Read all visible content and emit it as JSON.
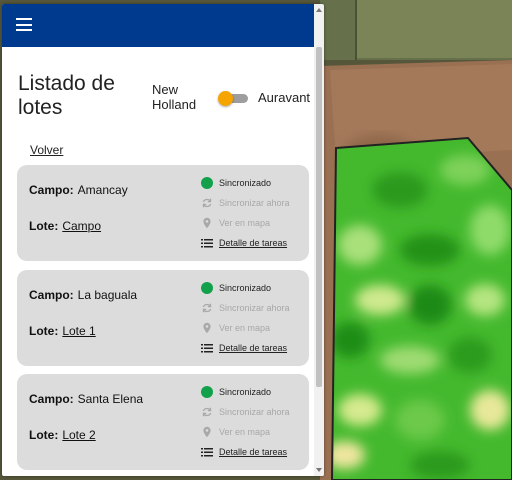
{
  "header": {
    "menu_icon": "hamburger-menu-icon",
    "color": "#003a8f"
  },
  "panel": {
    "title": "Listado de lotes",
    "brand_left": "New Holland",
    "brand_right": "Auravant",
    "toggle_color": "#f6a500",
    "back_label": "Volver"
  },
  "labels": {
    "campo": "Campo:",
    "lote": "Lote:",
    "sincronizado": "Sincronizado",
    "sincronizar": "Sincronizar ahora",
    "ver_mapa": "Ver en mapa",
    "detalle": "Detalle de tareas"
  },
  "cards": [
    {
      "campo": "Amancay",
      "lote": "Campo"
    },
    {
      "campo": "La baguala",
      "lote": "Lote 1"
    },
    {
      "campo": "Santa Elena",
      "lote": "Lote 2"
    }
  ],
  "colors": {
    "synced": "#12a14a",
    "card_bg": "#dcdcdc",
    "muted": "#a8a8a8"
  }
}
